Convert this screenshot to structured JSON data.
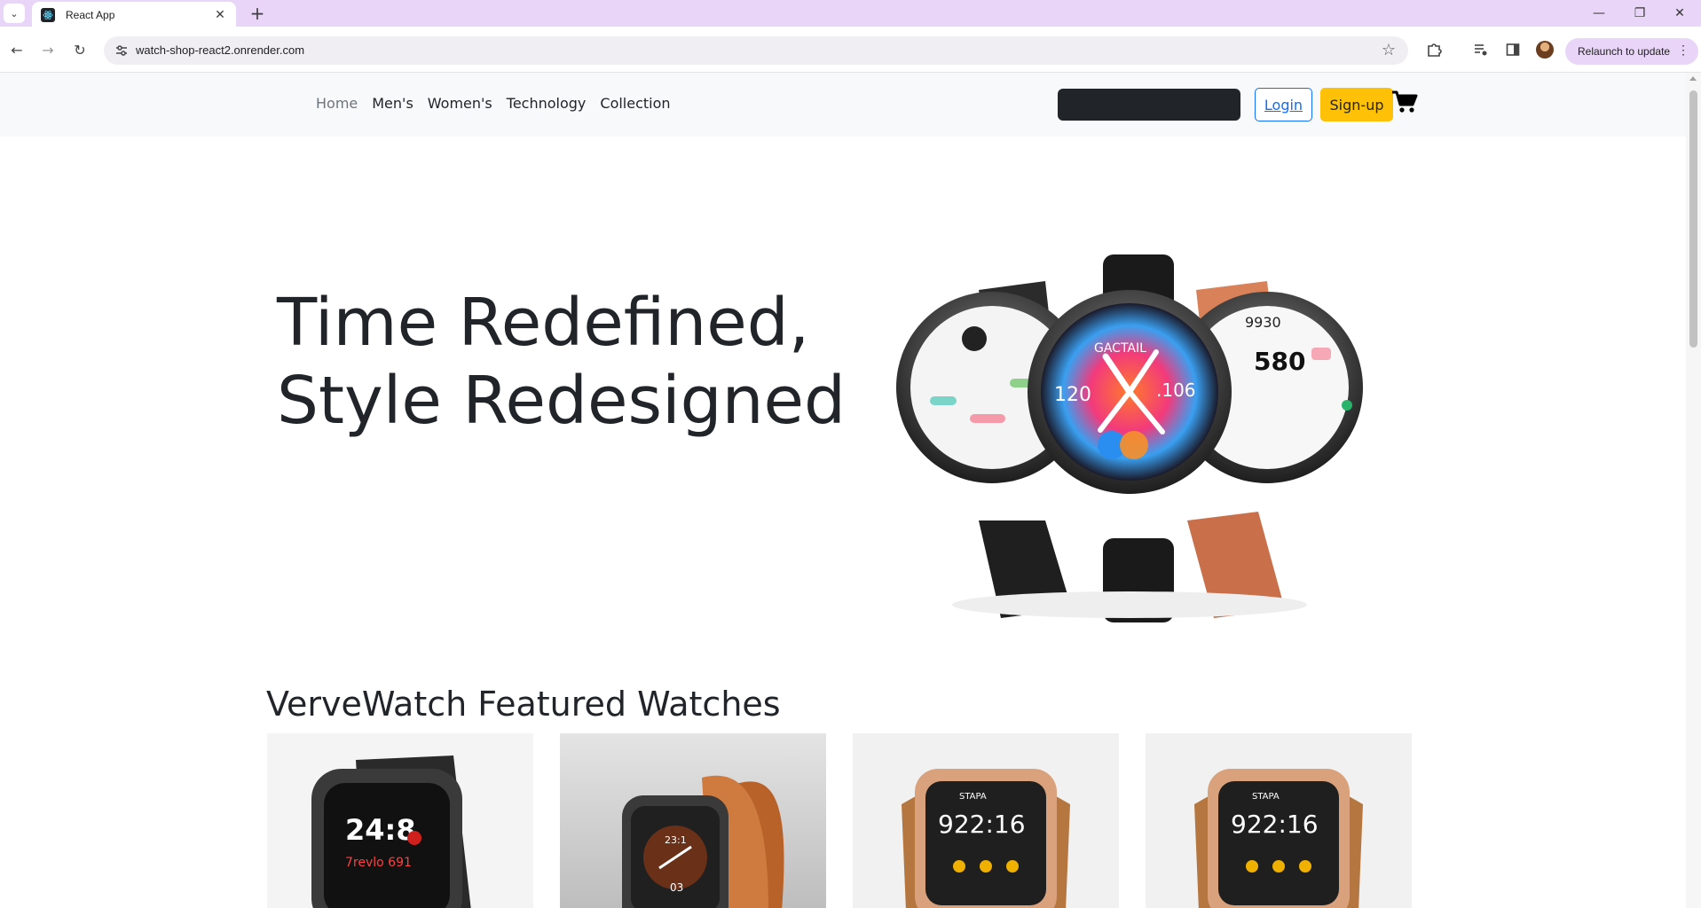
{
  "browser": {
    "tab_title": "React App",
    "url": "watch-shop-react2.onrender.com",
    "relaunch_label": "Relaunch to update",
    "accent_color": "#e8d5f8"
  },
  "site": {
    "nav": {
      "links": [
        "Home",
        "Men's",
        "Women's",
        "Technology",
        "Collection"
      ],
      "active": "Home"
    },
    "search": {
      "placeholder": ""
    },
    "login_label": "Login",
    "signup_label": "Sign-up",
    "signup_color": "#ffc107",
    "login_color": "#0d6efd"
  },
  "hero": {
    "line1": "Time Redefined,",
    "line2": "Style Redesigned",
    "image_face_texts": {
      "center_brand": "GACTAIL",
      "center_left": "120",
      "center_right": ".106",
      "right_top": "9930",
      "right_big": "580"
    }
  },
  "featured": {
    "title": "VerveWatch Featured Watches",
    "products": [
      {
        "face_time": "24:8",
        "face_sub": "7revlo 691",
        "strap": "black"
      },
      {
        "face_time": "23:1",
        "face_sub": "03",
        "strap": "brown"
      },
      {
        "face_time": "922:16",
        "face_sub": "STAPA",
        "strap": "white"
      },
      {
        "face_time": "922:16",
        "face_sub": "STAPA",
        "strap": "white"
      }
    ]
  }
}
